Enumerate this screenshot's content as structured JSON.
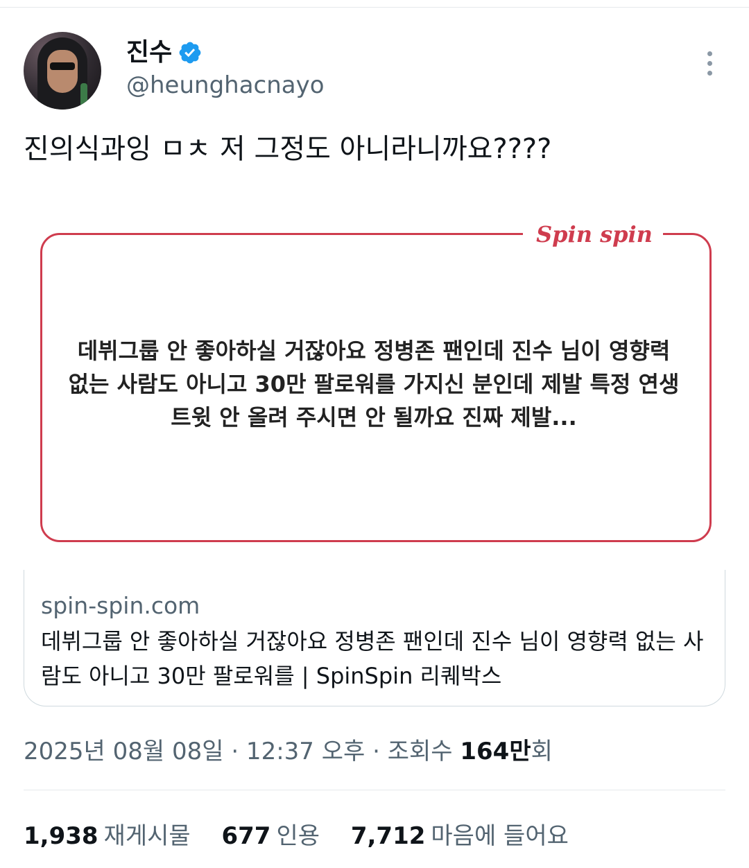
{
  "author": {
    "name": "진수",
    "handle": "@heunghacnayo",
    "verified": true
  },
  "tweet": {
    "text": "진의식과잉 ㅁㅊ 저 그정도 아니라니까요????"
  },
  "media": {
    "logo": "Spin spin",
    "quote": "데뷔그룹 안 좋아하실 거잖아요 정병존 팬인데 진수 님이 영향력 없는 사람도 아니고 30만 팔로워를 가지신 분인데 제발 특정 연생 트윗 안 올려 주시면 안 될까요 진짜 제발..."
  },
  "link_card": {
    "domain": "spin-spin.com",
    "title": "데뷔그룹 안 좋아하실 거잖아요 정병존 팬인데 진수 님이 영향력 없는 사람도 아니고 30만 팔로워를 | SpinSpin 리퀘박스"
  },
  "meta": {
    "timestamp": "2025년 08월 08일 · 12:37 오후 · 조회수 ",
    "views_number": "164만",
    "views_suffix": "회"
  },
  "stats": {
    "retweets_count": "1,938",
    "retweets_label": "재게시물",
    "quotes_count": "677",
    "quotes_label": "인용",
    "likes_count": "7,712",
    "likes_label": "마음에 들어요"
  },
  "colors": {
    "accent_red": "#cf3c4e",
    "verified_blue": "#1d9bf0",
    "secondary_text": "#536471"
  },
  "icons": [
    "verified-badge-icon",
    "more-options-icon"
  ]
}
